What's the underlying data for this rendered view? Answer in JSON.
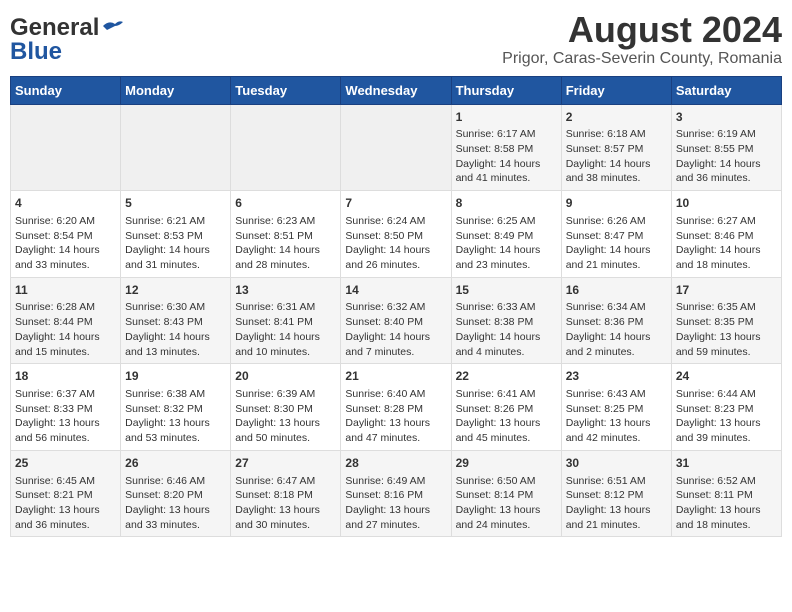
{
  "header": {
    "logo_general": "General",
    "logo_blue": "Blue",
    "title": "August 2024",
    "subtitle": "Prigor, Caras-Severin County, Romania"
  },
  "days_of_week": [
    "Sunday",
    "Monday",
    "Tuesday",
    "Wednesday",
    "Thursday",
    "Friday",
    "Saturday"
  ],
  "weeks": [
    [
      {
        "day": "",
        "info": ""
      },
      {
        "day": "",
        "info": ""
      },
      {
        "day": "",
        "info": ""
      },
      {
        "day": "",
        "info": ""
      },
      {
        "day": "1",
        "info": "Sunrise: 6:17 AM\nSunset: 8:58 PM\nDaylight: 14 hours\nand 41 minutes."
      },
      {
        "day": "2",
        "info": "Sunrise: 6:18 AM\nSunset: 8:57 PM\nDaylight: 14 hours\nand 38 minutes."
      },
      {
        "day": "3",
        "info": "Sunrise: 6:19 AM\nSunset: 8:55 PM\nDaylight: 14 hours\nand 36 minutes."
      }
    ],
    [
      {
        "day": "4",
        "info": "Sunrise: 6:20 AM\nSunset: 8:54 PM\nDaylight: 14 hours\nand 33 minutes."
      },
      {
        "day": "5",
        "info": "Sunrise: 6:21 AM\nSunset: 8:53 PM\nDaylight: 14 hours\nand 31 minutes."
      },
      {
        "day": "6",
        "info": "Sunrise: 6:23 AM\nSunset: 8:51 PM\nDaylight: 14 hours\nand 28 minutes."
      },
      {
        "day": "7",
        "info": "Sunrise: 6:24 AM\nSunset: 8:50 PM\nDaylight: 14 hours\nand 26 minutes."
      },
      {
        "day": "8",
        "info": "Sunrise: 6:25 AM\nSunset: 8:49 PM\nDaylight: 14 hours\nand 23 minutes."
      },
      {
        "day": "9",
        "info": "Sunrise: 6:26 AM\nSunset: 8:47 PM\nDaylight: 14 hours\nand 21 minutes."
      },
      {
        "day": "10",
        "info": "Sunrise: 6:27 AM\nSunset: 8:46 PM\nDaylight: 14 hours\nand 18 minutes."
      }
    ],
    [
      {
        "day": "11",
        "info": "Sunrise: 6:28 AM\nSunset: 8:44 PM\nDaylight: 14 hours\nand 15 minutes."
      },
      {
        "day": "12",
        "info": "Sunrise: 6:30 AM\nSunset: 8:43 PM\nDaylight: 14 hours\nand 13 minutes."
      },
      {
        "day": "13",
        "info": "Sunrise: 6:31 AM\nSunset: 8:41 PM\nDaylight: 14 hours\nand 10 minutes."
      },
      {
        "day": "14",
        "info": "Sunrise: 6:32 AM\nSunset: 8:40 PM\nDaylight: 14 hours\nand 7 minutes."
      },
      {
        "day": "15",
        "info": "Sunrise: 6:33 AM\nSunset: 8:38 PM\nDaylight: 14 hours\nand 4 minutes."
      },
      {
        "day": "16",
        "info": "Sunrise: 6:34 AM\nSunset: 8:36 PM\nDaylight: 14 hours\nand 2 minutes."
      },
      {
        "day": "17",
        "info": "Sunrise: 6:35 AM\nSunset: 8:35 PM\nDaylight: 13 hours\nand 59 minutes."
      }
    ],
    [
      {
        "day": "18",
        "info": "Sunrise: 6:37 AM\nSunset: 8:33 PM\nDaylight: 13 hours\nand 56 minutes."
      },
      {
        "day": "19",
        "info": "Sunrise: 6:38 AM\nSunset: 8:32 PM\nDaylight: 13 hours\nand 53 minutes."
      },
      {
        "day": "20",
        "info": "Sunrise: 6:39 AM\nSunset: 8:30 PM\nDaylight: 13 hours\nand 50 minutes."
      },
      {
        "day": "21",
        "info": "Sunrise: 6:40 AM\nSunset: 8:28 PM\nDaylight: 13 hours\nand 47 minutes."
      },
      {
        "day": "22",
        "info": "Sunrise: 6:41 AM\nSunset: 8:26 PM\nDaylight: 13 hours\nand 45 minutes."
      },
      {
        "day": "23",
        "info": "Sunrise: 6:43 AM\nSunset: 8:25 PM\nDaylight: 13 hours\nand 42 minutes."
      },
      {
        "day": "24",
        "info": "Sunrise: 6:44 AM\nSunset: 8:23 PM\nDaylight: 13 hours\nand 39 minutes."
      }
    ],
    [
      {
        "day": "25",
        "info": "Sunrise: 6:45 AM\nSunset: 8:21 PM\nDaylight: 13 hours\nand 36 minutes."
      },
      {
        "day": "26",
        "info": "Sunrise: 6:46 AM\nSunset: 8:20 PM\nDaylight: 13 hours\nand 33 minutes."
      },
      {
        "day": "27",
        "info": "Sunrise: 6:47 AM\nSunset: 8:18 PM\nDaylight: 13 hours\nand 30 minutes."
      },
      {
        "day": "28",
        "info": "Sunrise: 6:49 AM\nSunset: 8:16 PM\nDaylight: 13 hours\nand 27 minutes."
      },
      {
        "day": "29",
        "info": "Sunrise: 6:50 AM\nSunset: 8:14 PM\nDaylight: 13 hours\nand 24 minutes."
      },
      {
        "day": "30",
        "info": "Sunrise: 6:51 AM\nSunset: 8:12 PM\nDaylight: 13 hours\nand 21 minutes."
      },
      {
        "day": "31",
        "info": "Sunrise: 6:52 AM\nSunset: 8:11 PM\nDaylight: 13 hours\nand 18 minutes."
      }
    ]
  ]
}
